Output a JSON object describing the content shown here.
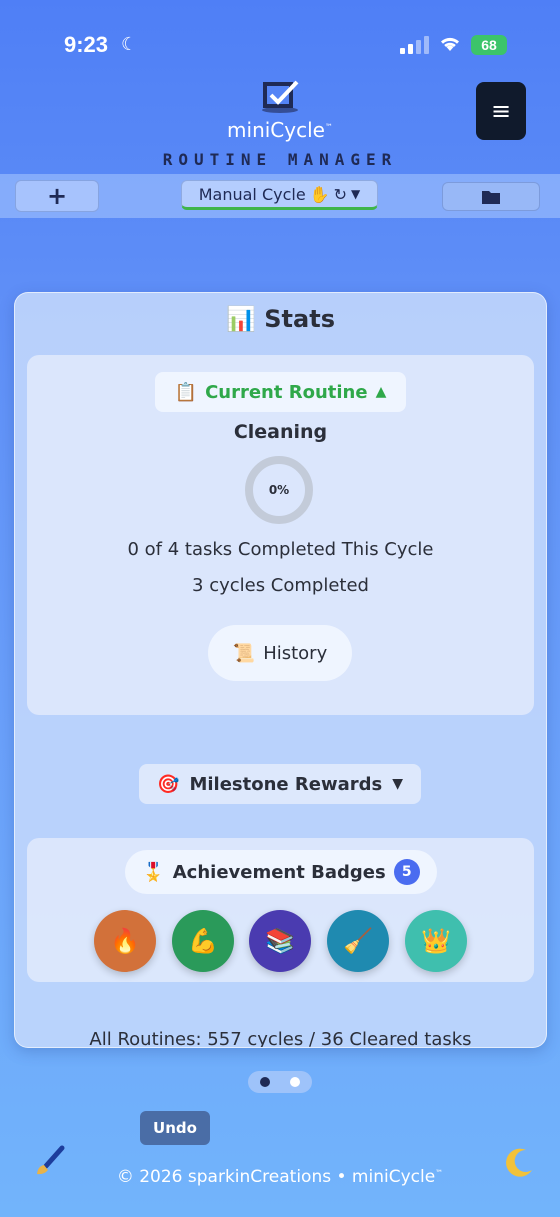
{
  "status_bar": {
    "time": "9:23",
    "battery": "68"
  },
  "header": {
    "app_name": "miniCycle",
    "trademark": "™",
    "subtitle": "ROUTINE MANAGER",
    "menu_icon": "hamburger-icon"
  },
  "toolbar": {
    "add_label": "+",
    "mode_label": "Manual Cycle",
    "mode_emoji": "✋",
    "mode_cycle_glyph": "↻",
    "mode_arrow": "▼",
    "folder_icon": "folder-icon"
  },
  "stats": {
    "icon": "📊",
    "title": "Stats",
    "current_routine": {
      "toggle_icon": "📋",
      "toggle_label": "Current Routine",
      "toggle_arrow": "▲",
      "name": "Cleaning",
      "progress_text": "0%",
      "progress_fraction": 0,
      "tasks_line": "0 of 4 tasks Completed This Cycle",
      "cycles_line": "3 cycles Completed",
      "history_icon": "📜",
      "history_label": "History"
    },
    "milestones": {
      "icon": "🎯",
      "label": "Milestone Rewards",
      "arrow": "▼"
    },
    "badges": {
      "icon": "🎖️",
      "label": "Achievement Badges",
      "count": "5",
      "items": [
        {
          "emoji": "🔥",
          "color": "#d2713a"
        },
        {
          "emoji": "💪",
          "color": "#2a9a5a"
        },
        {
          "emoji": "📚",
          "color": "#4a3bb0"
        },
        {
          "emoji": "🧹",
          "color": "#1f8ab0"
        },
        {
          "emoji": "👑",
          "color": "#3fbfae"
        }
      ]
    },
    "all_routines": "All Routines: 557 cycles / 36 Cleared tasks"
  },
  "pager": {
    "pages": 2,
    "active": 0
  },
  "undo_label": "Undo",
  "footer": {
    "text": "© 2026 sparkinCreations • miniCycle",
    "trademark": "™"
  },
  "colors": {
    "accent_green": "#2fa84a",
    "menu_bg": "#101a2c",
    "badge_count": "#4a6cf0",
    "undo_bg": "#4a6da6"
  }
}
